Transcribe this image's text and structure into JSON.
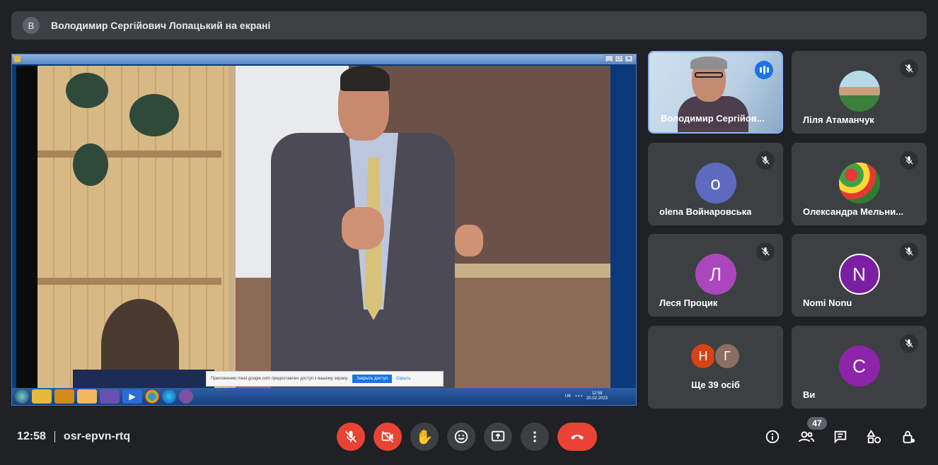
{
  "banner": {
    "avatar_letter": "В",
    "text": "Володимир Сергійович Лопацький на екрані"
  },
  "shared_screen": {
    "notification": {
      "text": "Приложению meet.google.com предоставлен доступ к вашему экрану.",
      "button": "Закрыть доступ",
      "hide": "Скрыть"
    },
    "taskbar": {
      "lang": "UK",
      "time": "12:58",
      "date": "20.02.2023"
    }
  },
  "participants": [
    {
      "name": "Володимир Сергійов...",
      "type": "camera",
      "speaking": true
    },
    {
      "name": "Ліля Атаманчук",
      "type": "photo",
      "muted": true
    },
    {
      "name": "olena Войнаровська",
      "type": "letter",
      "letter": "o",
      "color": "#5c6bc0",
      "muted": true
    },
    {
      "name": "Олександра Мельни...",
      "type": "photo",
      "muted": true
    },
    {
      "name": "Леся Процик",
      "type": "letter",
      "letter": "Л",
      "color": "#ab47bc",
      "muted": true
    },
    {
      "name": "Nomi Nonu",
      "type": "letter",
      "letter": "N",
      "color": "#7b1fa2",
      "muted": true
    },
    {
      "name": "Ще 39 осіб",
      "type": "group",
      "letters": [
        "Н",
        "Г"
      ]
    },
    {
      "name": "Ви",
      "type": "letter",
      "letter": "С",
      "color": "#8e24aa",
      "muted": true
    }
  ],
  "bottom": {
    "time": "12:58",
    "meeting_code": "osr-epvn-rtq",
    "people_count": "47"
  },
  "colors": {
    "hangup": "#ea4335",
    "active_border": "#8ab4f8",
    "speaking": "#1a73e8"
  }
}
